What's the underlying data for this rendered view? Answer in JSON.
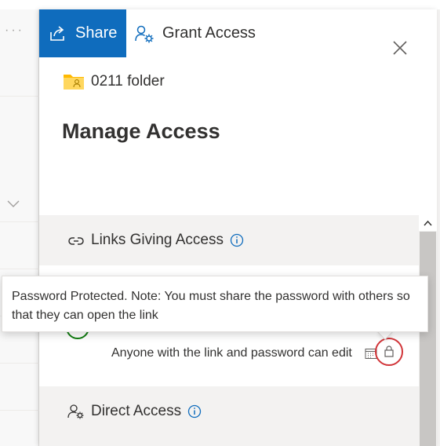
{
  "background": {
    "ellipsis": "···"
  },
  "panel": {
    "tabs": [
      {
        "label": "Share",
        "icon": "share-icon",
        "active": true
      },
      {
        "label": "Grant Access",
        "icon": "grant-access-icon",
        "active": false
      }
    ],
    "folder_name": "0211 folder",
    "title": "Manage Access",
    "links_section": {
      "heading": "Links Giving Access",
      "link_description": "Anyone with the link and password can edit"
    },
    "direct_section": {
      "heading": "Direct Access"
    }
  },
  "tooltip": {
    "text": "Password Protected. Note: You must share the password with others so that they can open the link"
  },
  "colors": {
    "accent": "#0f6cbd",
    "highlight_ring": "#d13438",
    "info_blue": "#0f6cbd"
  }
}
